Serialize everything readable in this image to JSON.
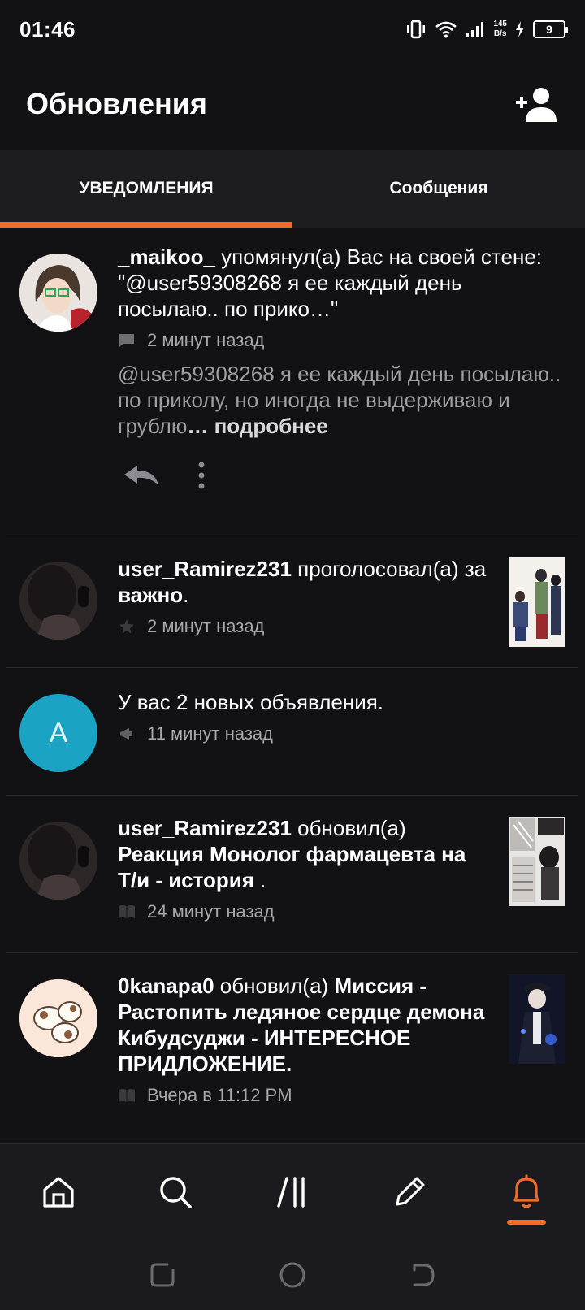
{
  "status_bar": {
    "time": "01:46",
    "net_speed_value": "145",
    "net_speed_unit": "B/s",
    "battery": "9"
  },
  "header": {
    "title": "Обновления"
  },
  "tabs": [
    {
      "label": "УВЕДОМЛЕНИЯ",
      "active": true
    },
    {
      "label": "Сообщения",
      "active": false
    }
  ],
  "notifications": [
    {
      "user": "_maikoo_",
      "action": " упомянул(а) Вас на своей стене: \"@user59308268 я ее каждый день посылаю.. по прико…\"",
      "time": "2 минут назад",
      "meta_icon": "comment-icon",
      "preview": "@user59308268 я ее каждый день посылаю.. по приколу, но иногда не выдерживаю и грублю",
      "more_label": "… подробнее"
    },
    {
      "user": "user_Ramirez231",
      "action": " проголосовал(а) за ",
      "target": "важно",
      "trail": ".",
      "time": "2 минут назад",
      "meta_icon": "star-icon"
    },
    {
      "avatar_letter": "A",
      "text": "У вас 2 новых объявления.",
      "time": "11 минут назад",
      "meta_icon": "megaphone-icon"
    },
    {
      "user": "user_Ramirez231",
      "action": " обновил(а) ",
      "target": "Реакция Монолог фармацевта на Т/и - история",
      "trail": " .",
      "time": "24 минут назад",
      "meta_icon": "book-icon"
    },
    {
      "user": "0kanapa0",
      "action": " обновил(а) ",
      "target": "Миссия - Растопить ледяное сердце демона Кибудсуджи - ИНТЕРЕСНОЕ ПРИДЛОЖЕНИЕ.",
      "time": "Вчера в 11:12 PM",
      "meta_icon": "book-icon"
    }
  ],
  "colors": {
    "accent": "#f06a2a",
    "background": "#121114",
    "tab_bar": "#1d1c20",
    "announce_avatar": "#1aa3c2"
  }
}
